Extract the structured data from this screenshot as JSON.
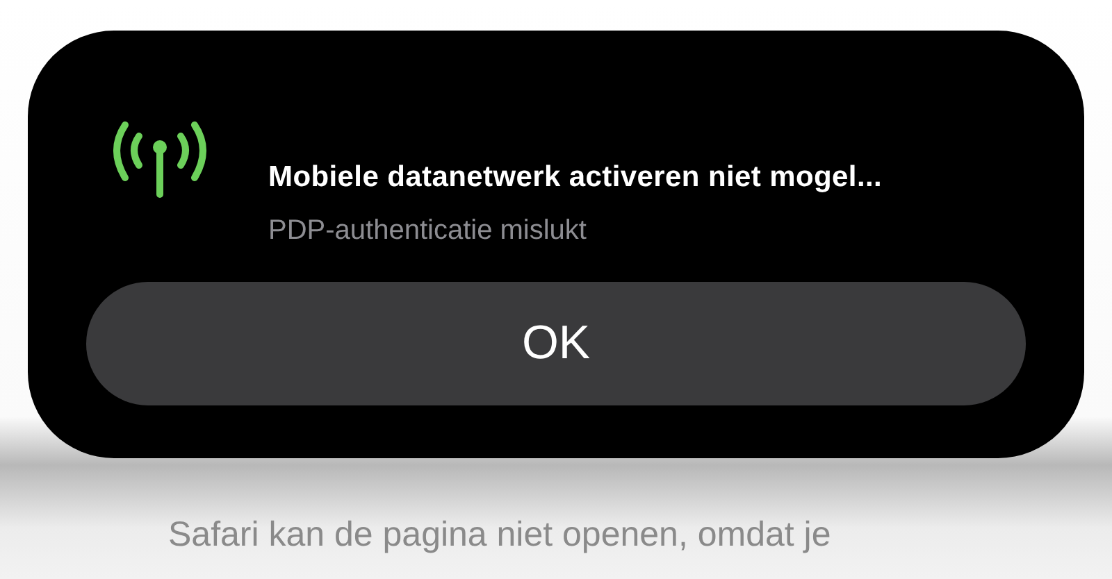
{
  "alert": {
    "title": "Mobiele datanetwerk activeren niet mogel...",
    "message": "PDP-authenticatie mislukt",
    "buttons": [
      {
        "label": "OK"
      }
    ]
  },
  "background_page": {
    "text": "Safari kan de pagina niet openen, omdat je"
  }
}
